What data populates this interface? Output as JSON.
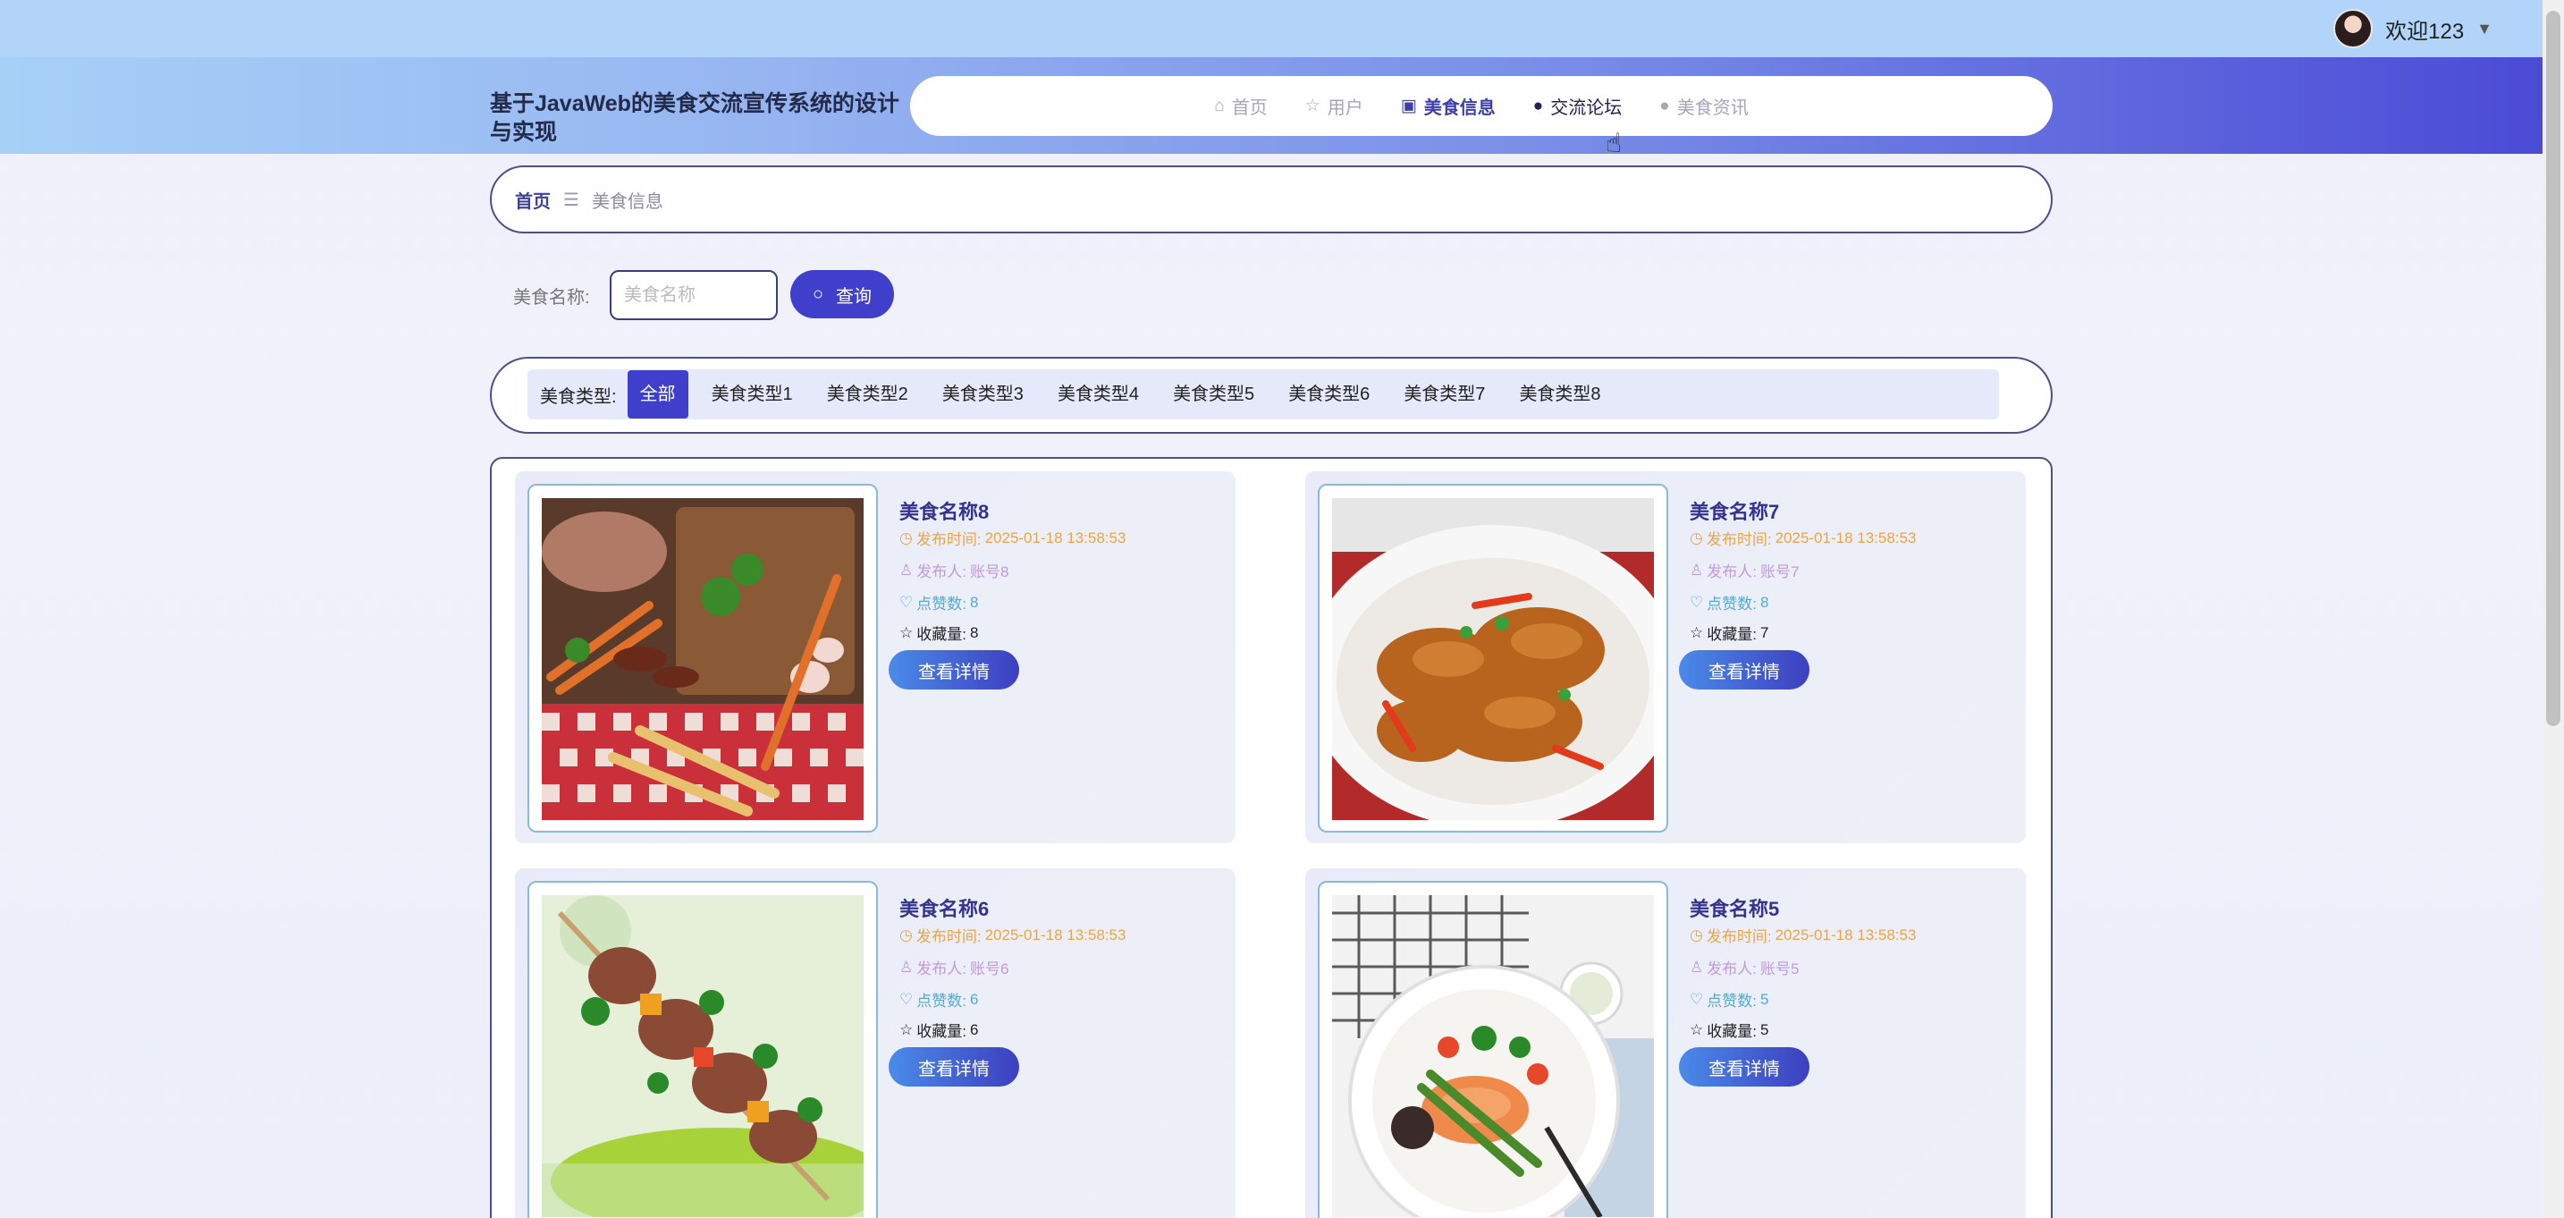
{
  "topbar": {
    "welcome": "欢迎123",
    "caret": "▼"
  },
  "site_title": "基于JavaWeb的美食交流宣传系统的设计与实现",
  "nav": [
    {
      "icon": "⌂",
      "label": "首页"
    },
    {
      "icon": "☆",
      "label": "用户"
    },
    {
      "icon": "▣",
      "label": "美食信息"
    },
    {
      "icon": "●",
      "label": "交流论坛"
    },
    {
      "icon": "●",
      "label": "美食资讯"
    }
  ],
  "breadcrumb": {
    "home": "首页",
    "sep": "☰",
    "current": "美食信息"
  },
  "search": {
    "label": "美食名称:",
    "placeholder": "美食名称",
    "button": "查询",
    "icon": "○"
  },
  "categories": {
    "label": "美食类型:",
    "items": [
      "全部",
      "美食类型1",
      "美食类型2",
      "美食类型3",
      "美食类型4",
      "美食类型5",
      "美食类型6",
      "美食类型7",
      "美食类型8"
    ]
  },
  "cards": [
    {
      "name": "美食名称8",
      "time_label": "发布时间:",
      "time": "2025-01-18 13:58:53",
      "poster_label": "发布人:",
      "poster": "账号8",
      "likes_label": "点赞数:",
      "likes": "8",
      "favs_label": "收藏量:",
      "favs": "8",
      "button": "查看详情"
    },
    {
      "name": "美食名称7",
      "time_label": "发布时间:",
      "time": "2025-01-18 13:58:53",
      "poster_label": "发布人:",
      "poster": "账号7",
      "likes_label": "点赞数:",
      "likes": "8",
      "favs_label": "收藏量:",
      "favs": "7",
      "button": "查看详情"
    },
    {
      "name": "美食名称6",
      "time_label": "发布时间:",
      "time": "2025-01-18 13:58:53",
      "poster_label": "发布人:",
      "poster": "账号6",
      "likes_label": "点赞数:",
      "likes": "6",
      "favs_label": "收藏量:",
      "favs": "6",
      "button": "查看详情"
    },
    {
      "name": "美食名称5",
      "time_label": "发布时间:",
      "time": "2025-01-18 13:58:53",
      "poster_label": "发布人:",
      "poster": "账号5",
      "likes_label": "点赞数:",
      "likes": "5",
      "favs_label": "收藏量:",
      "favs": "5",
      "button": "查看详情"
    }
  ],
  "icons": {
    "clock": "◷",
    "user": "♙",
    "thumb": "♡",
    "star": "☆"
  }
}
